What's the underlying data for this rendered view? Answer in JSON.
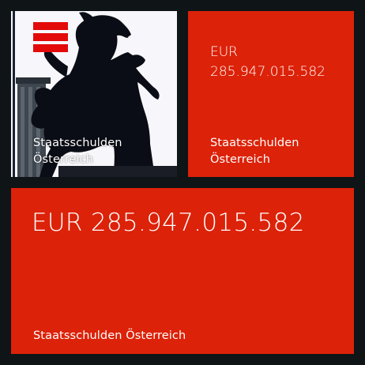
{
  "colors": {
    "background": "#0f1416",
    "tile_accent": "#dc2209",
    "flag_red": "#e30a0a",
    "flag_white": "#ffffff"
  },
  "tiles": {
    "image_tile": {
      "label": "Staatsschulden Österreich",
      "image": "horse-statue-silhouette",
      "badge_icon": "austria-flag-icon"
    },
    "medium_tile": {
      "currency": "EUR",
      "amount": "285.947.015.582",
      "label": "Staatsschulden Österreich"
    },
    "wide_tile": {
      "amount_text": "EUR 285.947.015.582",
      "label": "Staatsschulden Österreich"
    }
  }
}
